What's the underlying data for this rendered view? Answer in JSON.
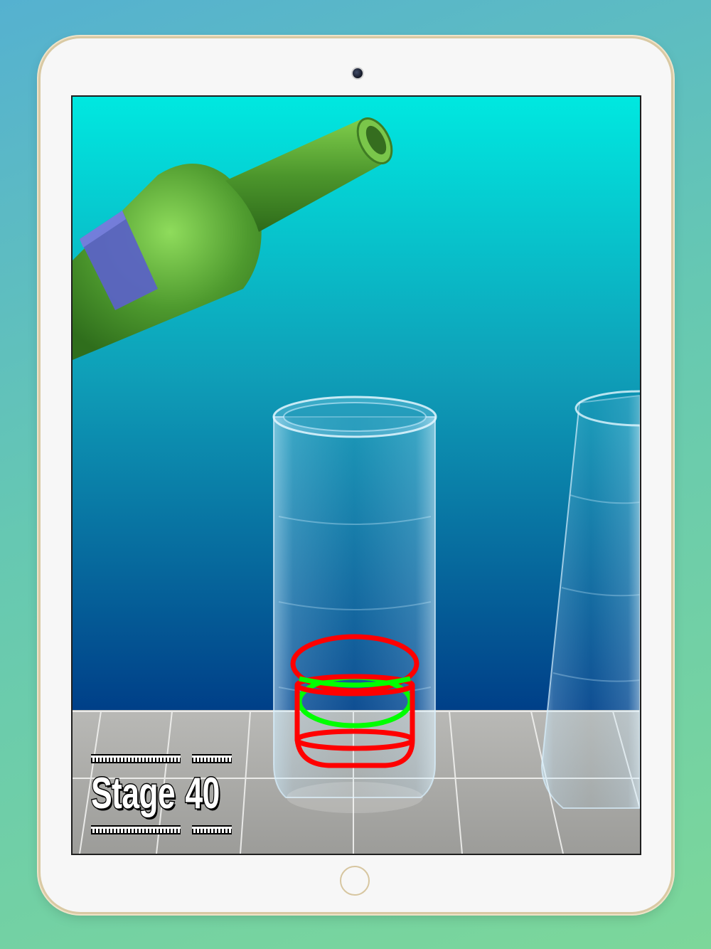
{
  "game": {
    "stage_label": "Stage",
    "stage_number": "40"
  },
  "colors": {
    "sky_top": "#00e8e0",
    "sky_bottom": "#003f88",
    "bottle_glass": "#5aa23a",
    "bottle_label": "#5b63c4",
    "target_ring": "#ff0000",
    "current_ring": "#00ff00",
    "floor_tile": "#a9a9a6"
  },
  "icons": {
    "front_camera": "camera-dot",
    "home": "home-button-ring"
  }
}
